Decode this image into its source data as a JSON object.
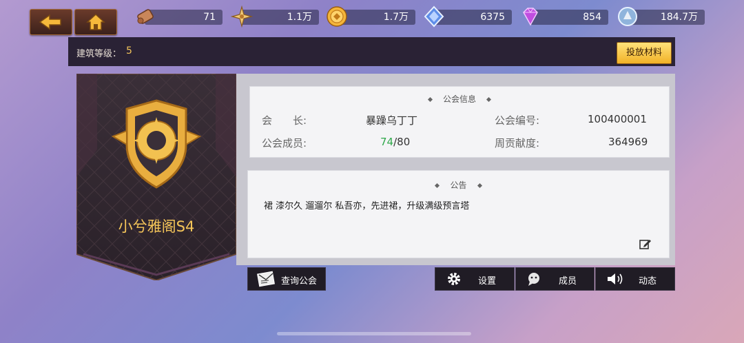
{
  "resources": [
    {
      "icon": "scroll-icon",
      "value": "71"
    },
    {
      "icon": "compass-star-icon",
      "value": "1.1万"
    },
    {
      "icon": "gold-coin-icon",
      "value": "1.7万"
    },
    {
      "icon": "blue-crystal-icon",
      "value": "6375"
    },
    {
      "icon": "purple-diamond-icon",
      "value": "854"
    },
    {
      "icon": "silver-orb-icon",
      "value": "184.7万"
    }
  ],
  "building": {
    "level_label": "建筑等级：",
    "level_value": "5",
    "donate_button": "投放材料"
  },
  "guild": {
    "name": "小兮雅阁S4"
  },
  "info": {
    "title": "公会信息",
    "leader_label": "会　　长:",
    "leader_value": "暴躁乌丁丁",
    "id_label": "公会编号:",
    "id_value": "100400001",
    "members_label": "公会成员:",
    "members_current": "74",
    "members_max": "/80",
    "contribution_label": "周贡献度:",
    "contribution_value": "364969"
  },
  "notice": {
    "title": "公告",
    "text": "裙 漆尔久 遛遛尔 私吾亦，先进裙，升级满级预言塔"
  },
  "buttons": {
    "query": "查询公会",
    "settings": "设置",
    "members": "成员",
    "activity": "动态"
  },
  "colors": {
    "accent": "#f6c659",
    "members_green": "#2fa84a"
  }
}
